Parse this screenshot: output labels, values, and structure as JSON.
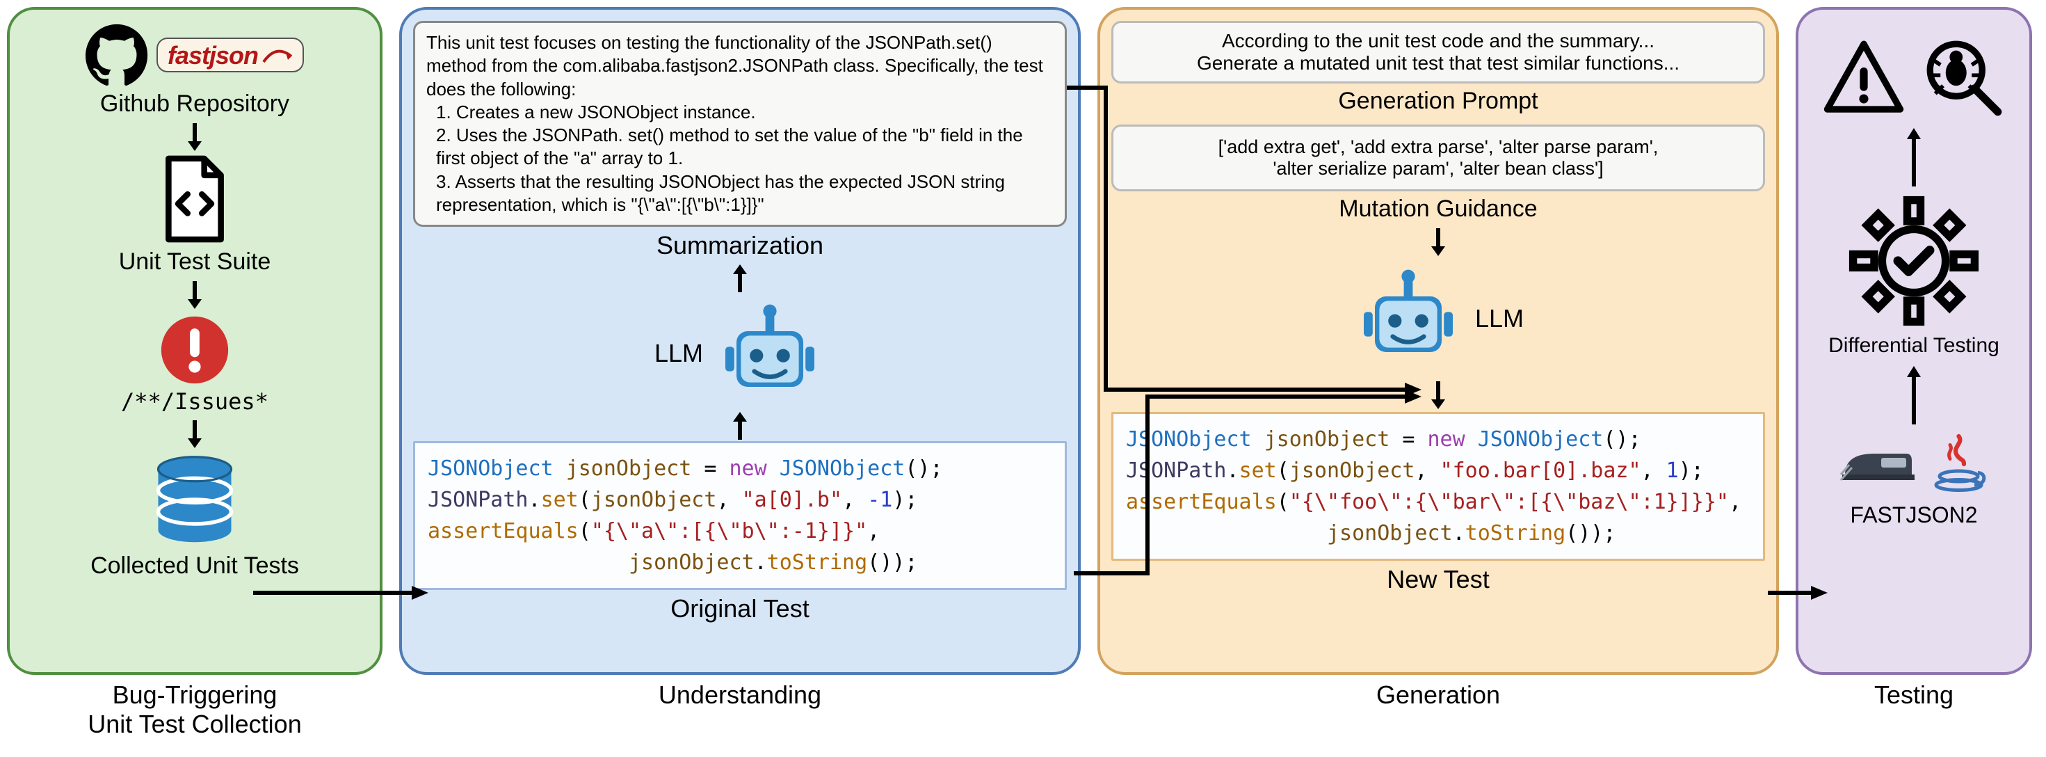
{
  "stage1": {
    "caption": "Bug-Triggering\nUnit Test Collection",
    "repo_label": "Github Repository",
    "suite_label": "Unit Test Suite",
    "issues_path": "/**/Issues*",
    "collected_label": "Collected Unit Tests",
    "fastjson_word": "fastjson"
  },
  "stage2": {
    "caption": "Understanding",
    "summary_lines": [
      "This unit test focuses on testing the functionality of the JSONPath.set() method from the com.alibaba.fastjson2.JSONPath class. Specifically, the test does the following:",
      " 1. Creates a new JSONObject instance.",
      " 2. Uses the JSONPath. set() method to set the value of the \"b\" field in the first object of the \"a\" array to 1.",
      " 3. Asserts that the resulting JSONObject has the expected JSON string representation, which is \"{\\\"a\\\":[{\\\"b\\\":1}]}\""
    ],
    "summarization_label": "Summarization",
    "llm_label": "LLM",
    "original_test_label": "Original Test",
    "code": {
      "l1": {
        "type": "JSONObject",
        "var": "jsonObject",
        "eq": "=",
        "new": "new",
        "ctor": "JSONObject",
        "paren": "();"
      },
      "l2": {
        "cls": "JSONPath",
        "dot": ".",
        "fn": "set",
        "open": "(",
        "arg1": "jsonObject",
        "c1": ", ",
        "str1": "\"a[0].b\"",
        "c2": ", ",
        "num": "-1",
        "close": ");"
      },
      "l3": {
        "fn": "assertEquals",
        "open": "(",
        "str": "\"{\\\"a\\\":[{\\\"b\\\":-1}]}\"",
        "comma": ","
      },
      "l4": {
        "indent": "                ",
        "var": "jsonObject",
        "dot": ".",
        "fn": "toString",
        "paren": "());"
      }
    }
  },
  "stage3": {
    "caption": "Generation",
    "prompt_lines": [
      "According to the unit test code and the summary...",
      "Generate a mutated unit test that test similar functions..."
    ],
    "prompt_label": "Generation Prompt",
    "guidance_text": "['add extra get', 'add extra parse', 'alter parse param',\n'alter serialize param', 'alter bean class']",
    "guidance_label": "Mutation Guidance",
    "llm_label": "LLM",
    "new_test_label": "New Test",
    "code": {
      "l1": {
        "type": "JSONObject",
        "var": "jsonObject",
        "eq": "=",
        "new": "new",
        "ctor": "JSONObject",
        "paren": "();"
      },
      "l2": {
        "cls": "JSONPath",
        "dot": ".",
        "fn": "set",
        "open": "(",
        "arg1": "jsonObject",
        "c1": ", ",
        "str1": "\"foo.bar[0].baz\"",
        "c2": ", ",
        "num": "1",
        "close": ");"
      },
      "l3": {
        "fn": "assertEquals",
        "open": "(",
        "str": "\"{\\\"foo\\\":{\\\"bar\\\":[{\\\"baz\\\":1}]}}\"",
        "comma": ","
      },
      "l4": {
        "indent": "                ",
        "var": "jsonObject",
        "dot": ".",
        "fn": "toString",
        "paren": "());"
      }
    }
  },
  "stage4": {
    "caption": "Testing",
    "diff_label": "Differential Testing",
    "fj2_label": "FASTJSON2"
  },
  "icons": {
    "github": "github-icon",
    "file": "code-file-icon",
    "exclaim": "exclamation-icon",
    "database": "database-icon",
    "robot": "llm-robot-icon",
    "warning": "warning-triangle-icon",
    "bug": "bug-magnifier-icon",
    "gear": "gear-check-icon",
    "train": "train-icon",
    "java": "java-icon"
  }
}
